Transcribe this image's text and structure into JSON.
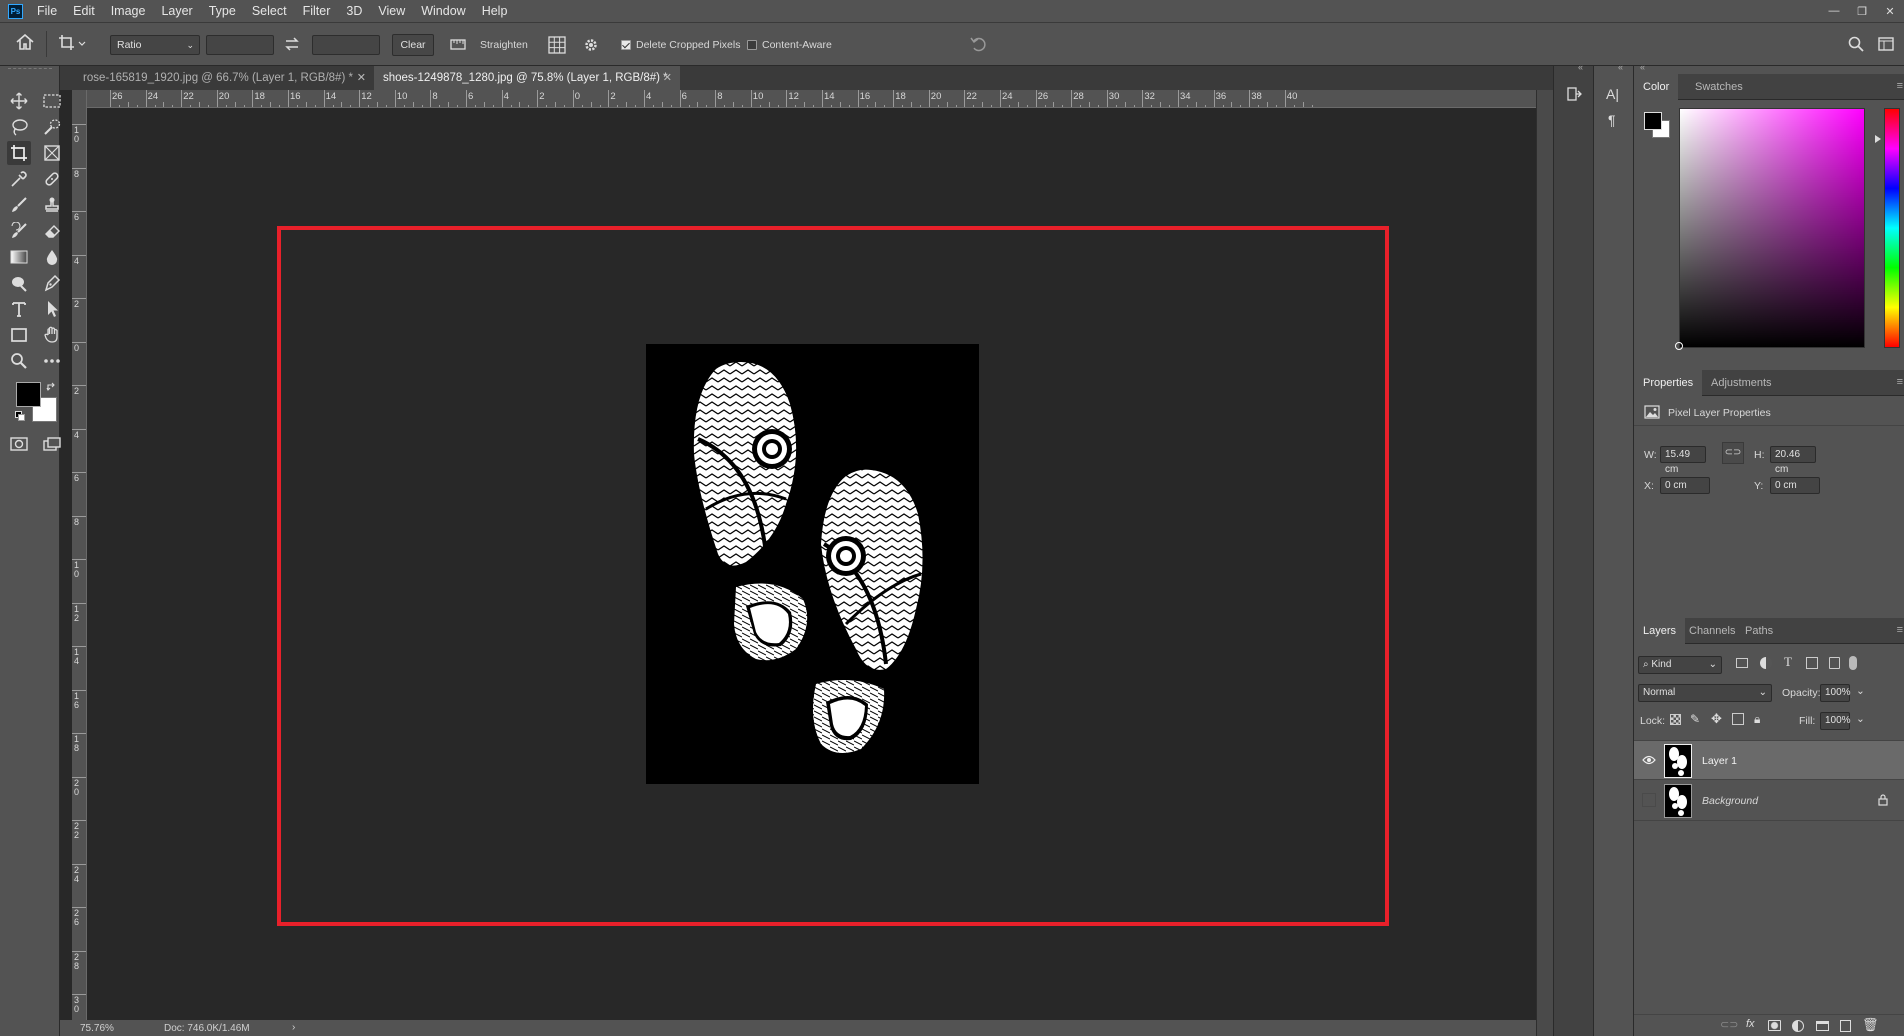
{
  "app": {
    "logo": "Ps"
  },
  "menu": [
    "File",
    "Edit",
    "Image",
    "Layer",
    "Type",
    "Select",
    "Filter",
    "3D",
    "View",
    "Window",
    "Help"
  ],
  "options": {
    "ratio_label": "Ratio",
    "clear_label": "Clear",
    "straighten_label": "Straighten",
    "delete_cropped_label": "Delete Cropped Pixels",
    "delete_cropped_checked": true,
    "content_aware_label": "Content-Aware",
    "content_aware_checked": false
  },
  "tabs": [
    {
      "label": "rose-165819_1920.jpg @ 66.7% (Layer 1, RGB/8#) *",
      "active": false
    },
    {
      "label": "shoes-1249878_1280.jpg @ 75.8% (Layer 1, RGB/8#) *",
      "active": true
    }
  ],
  "ruler_top": [
    "26",
    "24",
    "22",
    "20",
    "18",
    "16",
    "14",
    "12",
    "10",
    "8",
    "6",
    "4",
    "2",
    "0",
    "2",
    "4",
    "6",
    "8",
    "10",
    "12",
    "14",
    "16",
    "18",
    "20",
    "22",
    "24",
    "26",
    "28",
    "30",
    "32",
    "34",
    "36",
    "38",
    "40"
  ],
  "ruler_left": [
    "1 0",
    "8",
    "6",
    "4",
    "2",
    "0",
    "2",
    "4",
    "6",
    "8",
    "1 0",
    "1 2",
    "1 4",
    "1 6",
    "1 8",
    "2 0",
    "2 2",
    "2 4",
    "2 6",
    "2 8",
    "3 0"
  ],
  "status": {
    "zoom": "75.76%",
    "doc": "Doc: 746.0K/1.46M"
  },
  "color_panel": {
    "tabs": [
      "Color",
      "Swatches"
    ],
    "active": "Color",
    "fg": "#000000",
    "bg": "#ffffff",
    "hue": "#ff00ff"
  },
  "properties": {
    "tabs": [
      "Properties",
      "Adjustments"
    ],
    "title": "Pixel Layer Properties",
    "w_label": "W:",
    "w": "15.49 cm",
    "h_label": "H:",
    "h": "20.46 cm",
    "x_label": "X:",
    "x": "0 cm",
    "y_label": "Y:",
    "y": "0 cm"
  },
  "layers": {
    "tabs": [
      "Layers",
      "Channels",
      "Paths"
    ],
    "kind": "Kind",
    "blend": "Normal",
    "opacity_label": "Opacity:",
    "opacity": "100%",
    "lock_label": "Lock:",
    "fill_label": "Fill:",
    "fill": "100%",
    "items": [
      {
        "name": "Layer 1",
        "visible": true,
        "selected": true
      },
      {
        "name": "Background",
        "visible": false,
        "selected": false,
        "locked": true
      }
    ]
  },
  "colors": {
    "crop_frame": "#e8202a",
    "ui_bg": "#535353",
    "canvas_bg": "#282828"
  }
}
